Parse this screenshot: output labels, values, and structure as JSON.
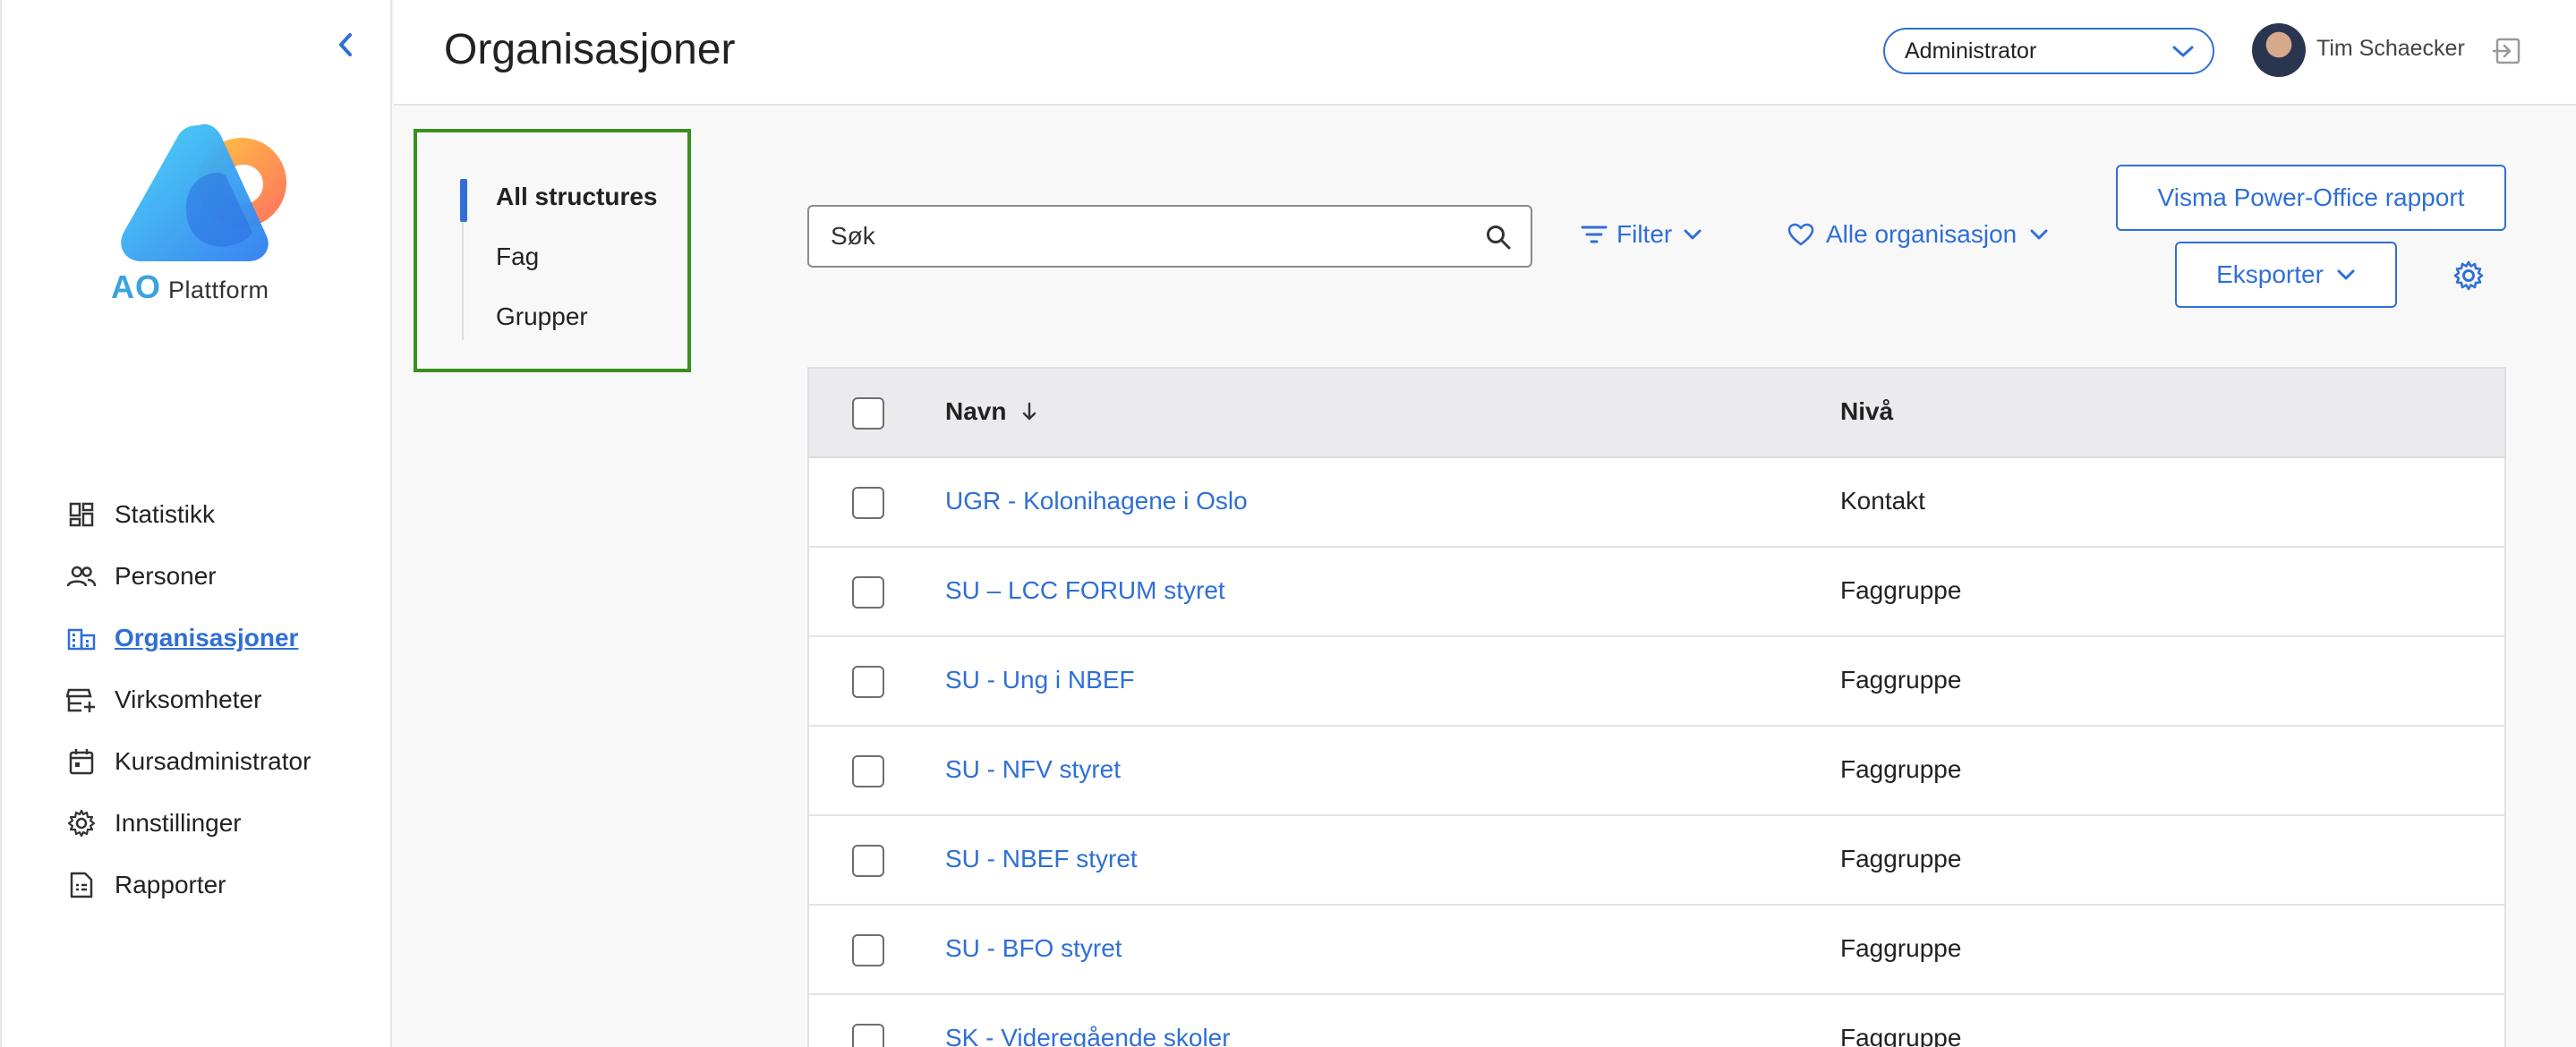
{
  "app": {
    "logo_mark": "AO",
    "logo_text": "Plattform"
  },
  "sidebar": {
    "items": [
      {
        "label": "Statistikk",
        "icon": "dashboard-icon",
        "active": false
      },
      {
        "label": "Personer",
        "icon": "people-icon",
        "active": false
      },
      {
        "label": "Organisasjoner",
        "icon": "building-icon",
        "active": true
      },
      {
        "label": "Virksomheter",
        "icon": "store-add-icon",
        "active": false
      },
      {
        "label": "Kursadministrator",
        "icon": "calendar-icon",
        "active": false
      },
      {
        "label": "Innstillinger",
        "icon": "gear-icon",
        "active": false
      },
      {
        "label": "Rapporter",
        "icon": "report-icon",
        "active": false
      }
    ]
  },
  "header": {
    "title": "Organisasjoner",
    "role": "Administrator",
    "user_name": "Tim Schaecker"
  },
  "structures": {
    "items": [
      {
        "label": "All structures",
        "active": true
      },
      {
        "label": "Fag",
        "active": false
      },
      {
        "label": "Grupper",
        "active": false
      }
    ]
  },
  "toolbar": {
    "search_placeholder": "Søk",
    "filter_label": "Filter",
    "favorites_label": "Alle organisasjon",
    "report_button": "Visma Power-Office rapport",
    "export_button": "Eksporter"
  },
  "table": {
    "columns": {
      "name": "Navn",
      "level": "Nivå"
    },
    "rows": [
      {
        "name": "UGR - Kolonihagene i Oslo",
        "level": "Kontakt"
      },
      {
        "name": "SU – LCC FORUM styret",
        "level": "Faggruppe"
      },
      {
        "name": "SU - Ung i NBEF",
        "level": "Faggruppe"
      },
      {
        "name": "SU - NFV styret",
        "level": "Faggruppe"
      },
      {
        "name": "SU - NBEF styret",
        "level": "Faggruppe"
      },
      {
        "name": "SU - BFO styret",
        "level": "Faggruppe"
      },
      {
        "name": "SK - Videregående skoler",
        "level": "Faggruppe"
      }
    ]
  },
  "colors": {
    "accent": "#2f6fd6",
    "highlight_border": "#3a8f1f"
  }
}
